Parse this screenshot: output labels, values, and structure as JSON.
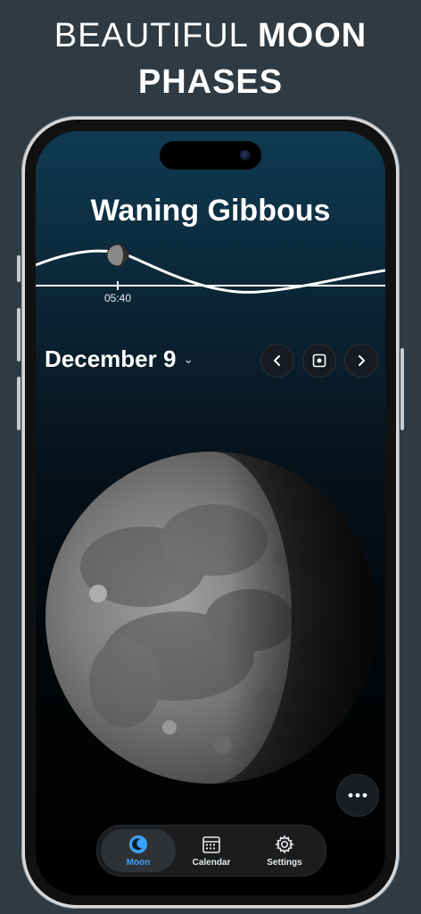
{
  "promo": {
    "headline_light": "BEAUTIFUL",
    "headline_bold_1": "MOON",
    "headline_bold_2": "PHASES"
  },
  "moon_view": {
    "phase_name": "Waning Gibbous",
    "wave_time_label": "05:40",
    "date_label": "December 9"
  },
  "controls": {
    "prev_icon": "chevron-left-icon",
    "today_icon": "target-square-icon",
    "next_icon": "chevron-right-icon",
    "more_icon": "more-dots-icon"
  },
  "tabbar": {
    "tabs": [
      {
        "label": "Moon",
        "icon": "moon-icon",
        "active": true
      },
      {
        "label": "Calendar",
        "icon": "calendar-icon",
        "active": false
      },
      {
        "label": "Settings",
        "icon": "gear-icon",
        "active": false
      }
    ]
  },
  "colors": {
    "accent": "#3aa3ff",
    "background": "#2f3a42"
  }
}
